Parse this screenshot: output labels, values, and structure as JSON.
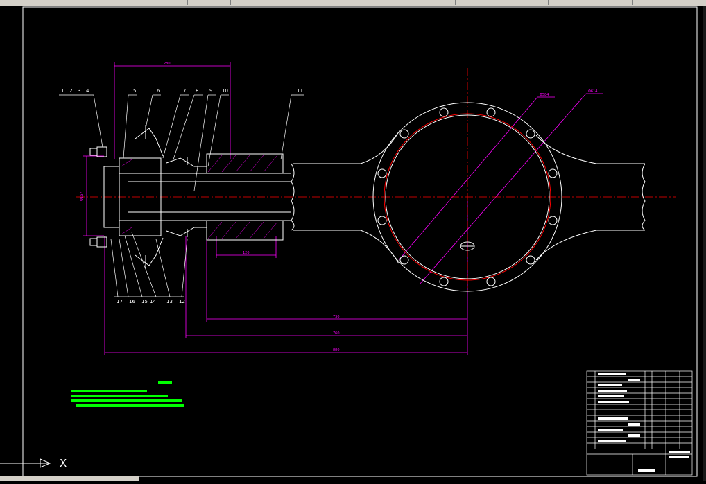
{
  "part_numbers_top": [
    "1",
    "2",
    "3",
    "4",
    "5",
    "6",
    "7",
    "8",
    "9",
    "10",
    "11"
  ],
  "part_numbers_bottom": [
    "17",
    "16",
    "15",
    "14",
    "13",
    "12"
  ],
  "dimensions": {
    "top_width": "280",
    "left_height": "Φ167",
    "small_bottom": "120",
    "dim_1": "730",
    "dim_2": "760",
    "dim_3": "880",
    "circle_r1": "Φ584",
    "circle_r2": "Φ614"
  },
  "axis_label": "X",
  "colors": {
    "background": "#000000",
    "line": "#ffffff",
    "dimension": "#ff00ff",
    "centerline": "#ff0000",
    "notes": "#00ff00"
  }
}
